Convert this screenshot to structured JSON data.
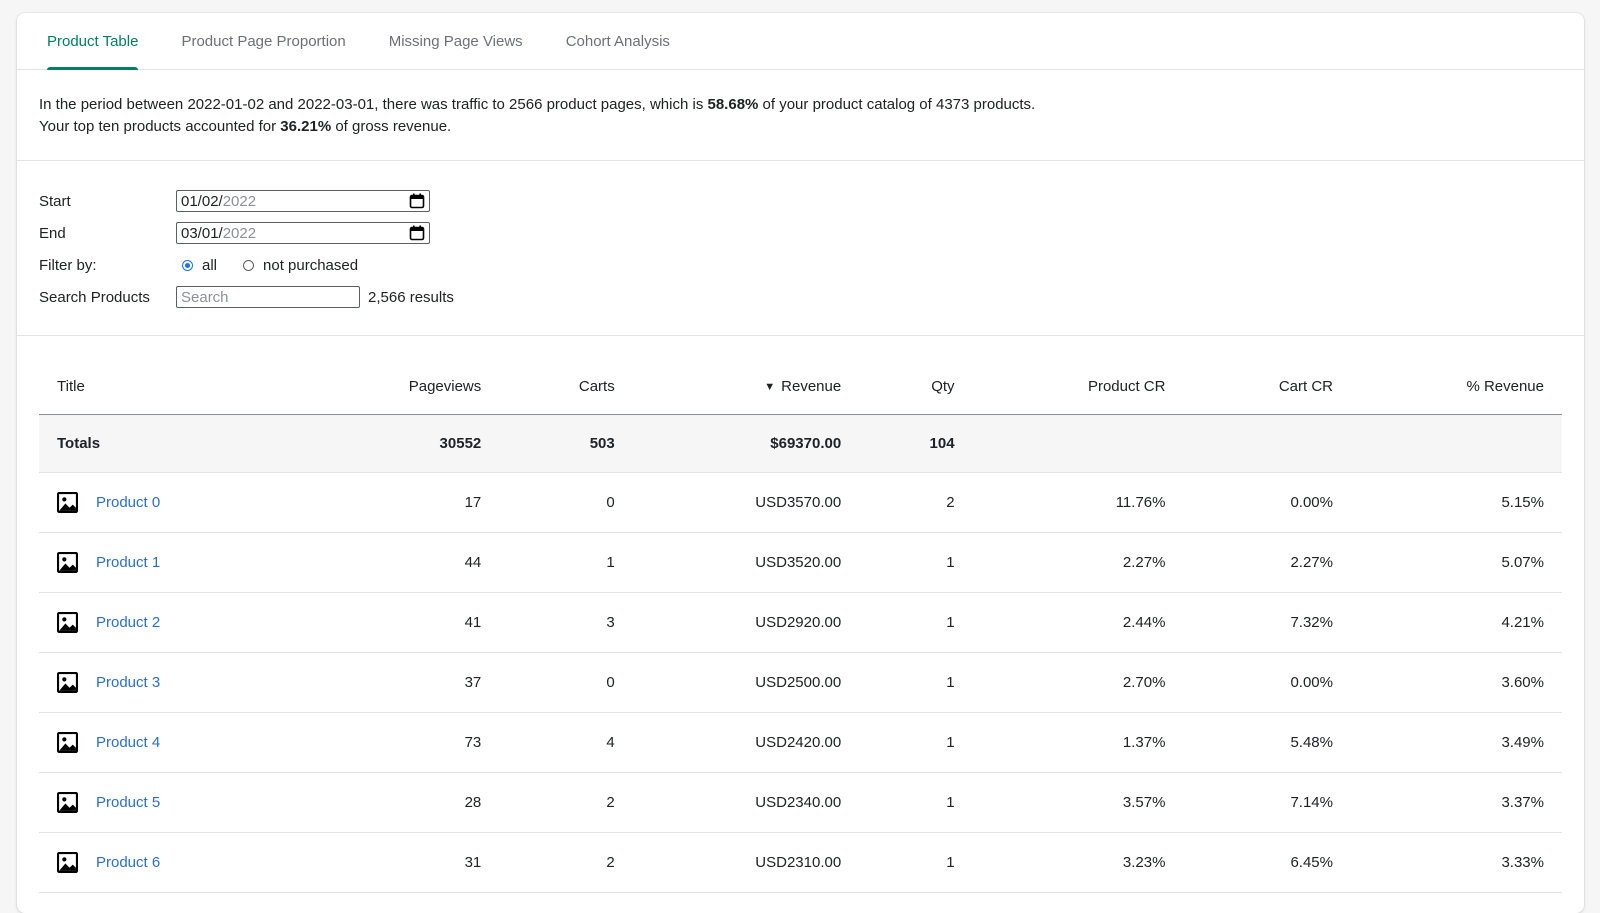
{
  "tabs": [
    "Product Table",
    "Product Page Proportion",
    "Missing Page Views",
    "Cohort Analysis"
  ],
  "active_tab_color": "#008060",
  "summary": {
    "line1_pre": "In the period between 2022-01-02 and 2022-03-01, there was traffic to 2566 product pages, which is ",
    "line1_pct": "58.68%",
    "line1_post": " of your product catalog of 4373 products.",
    "line2_pre": "Your top ten products accounted for ",
    "line2_pct": "36.21%",
    "line2_post": " of gross revenue."
  },
  "filters": {
    "start_label": "Start",
    "start_value_main": "01/02/",
    "start_value_dim": "2022",
    "end_label": "End",
    "end_value_main": "03/01/",
    "end_value_dim": "2022",
    "filter_label": "Filter by:",
    "radio_all": "all",
    "radio_not_purchased": "not purchased",
    "search_label": "Search Products",
    "search_placeholder": "Search",
    "results": "2,566 results"
  },
  "table": {
    "headers": [
      "Title",
      "Pageviews",
      "Carts",
      "Revenue",
      "Qty",
      "Product CR",
      "Cart CR",
      "% Revenue"
    ],
    "sort_icon": "caret-down-icon",
    "totals": {
      "label": "Totals",
      "pageviews": "30552",
      "carts": "503",
      "revenue": "$69370.00",
      "qty": "104"
    },
    "rows": [
      {
        "title": "Product 0",
        "pageviews": "17",
        "carts": "0",
        "revenue": "USD3570.00",
        "qty": "2",
        "product_cr": "11.76%",
        "cart_cr": "0.00%",
        "pct_revenue": "5.15%"
      },
      {
        "title": "Product 1",
        "pageviews": "44",
        "carts": "1",
        "revenue": "USD3520.00",
        "qty": "1",
        "product_cr": "2.27%",
        "cart_cr": "2.27%",
        "pct_revenue": "5.07%"
      },
      {
        "title": "Product 2",
        "pageviews": "41",
        "carts": "3",
        "revenue": "USD2920.00",
        "qty": "1",
        "product_cr": "2.44%",
        "cart_cr": "7.32%",
        "pct_revenue": "4.21%"
      },
      {
        "title": "Product 3",
        "pageviews": "37",
        "carts": "0",
        "revenue": "USD2500.00",
        "qty": "1",
        "product_cr": "2.70%",
        "cart_cr": "0.00%",
        "pct_revenue": "3.60%"
      },
      {
        "title": "Product 4",
        "pageviews": "73",
        "carts": "4",
        "revenue": "USD2420.00",
        "qty": "1",
        "product_cr": "1.37%",
        "cart_cr": "5.48%",
        "pct_revenue": "3.49%"
      },
      {
        "title": "Product 5",
        "pageviews": "28",
        "carts": "2",
        "revenue": "USD2340.00",
        "qty": "1",
        "product_cr": "3.57%",
        "cart_cr": "7.14%",
        "pct_revenue": "3.37%"
      },
      {
        "title": "Product 6",
        "pageviews": "31",
        "carts": "2",
        "revenue": "USD2310.00",
        "qty": "1",
        "product_cr": "3.23%",
        "cart_cr": "6.45%",
        "pct_revenue": "3.33%"
      }
    ]
  }
}
